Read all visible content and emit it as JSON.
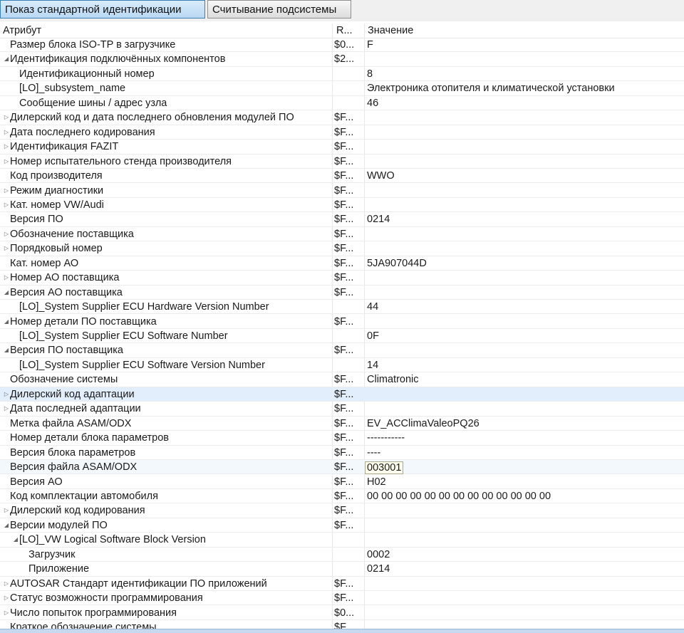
{
  "tabs": [
    {
      "label": "Показ стандартной идентификации",
      "active": true
    },
    {
      "label": "Считывание подсистемы",
      "active": false
    }
  ],
  "columns": {
    "attribute": "Атрибут",
    "raw": "R...",
    "value": "Значение"
  },
  "rows": [
    {
      "attr": "Размер блока ISO-TP в загрузчике",
      "level": 0,
      "toggle": "none",
      "raw": "$0...",
      "value": "F"
    },
    {
      "attr": "Идентификация подключённых компонентов",
      "level": 0,
      "toggle": "expanded",
      "raw": "$2...",
      "value": ""
    },
    {
      "attr": "Идентификационный номер",
      "level": 1,
      "toggle": "none",
      "raw": "",
      "value": "8"
    },
    {
      "attr": "[LO]_subsystem_name",
      "level": 1,
      "toggle": "none",
      "raw": "",
      "value": "Электроника отопителя и климатической установки"
    },
    {
      "attr": "Сообщение шины / адрес узла",
      "level": 1,
      "toggle": "none",
      "raw": "",
      "value": "46"
    },
    {
      "attr": "Дилерский код и дата последнего обновления модулей ПО",
      "level": 0,
      "toggle": "collapsed",
      "raw": "$F...",
      "value": ""
    },
    {
      "attr": "Дата последнего кодирования",
      "level": 0,
      "toggle": "collapsed",
      "raw": "$F...",
      "value": ""
    },
    {
      "attr": "Идентификация FAZIT",
      "level": 0,
      "toggle": "collapsed",
      "raw": "$F...",
      "value": ""
    },
    {
      "attr": "Номер испытательного стенда производителя",
      "level": 0,
      "toggle": "collapsed",
      "raw": "$F...",
      "value": ""
    },
    {
      "attr": "Код производителя",
      "level": 0,
      "toggle": "none",
      "raw": "$F...",
      "value": "WWO"
    },
    {
      "attr": "Режим диагностики",
      "level": 0,
      "toggle": "collapsed",
      "raw": "$F...",
      "value": ""
    },
    {
      "attr": "Кат. номер VW/Audi",
      "level": 0,
      "toggle": "collapsed",
      "raw": "$F...",
      "value": ""
    },
    {
      "attr": "Версия ПО",
      "level": 0,
      "toggle": "none",
      "raw": "$F...",
      "value": "0214"
    },
    {
      "attr": "Обозначение поставщика",
      "level": 0,
      "toggle": "collapsed",
      "raw": "$F...",
      "value": ""
    },
    {
      "attr": "Порядковый номер",
      "level": 0,
      "toggle": "collapsed",
      "raw": "$F...",
      "value": ""
    },
    {
      "attr": "Кат. номер АО",
      "level": 0,
      "toggle": "none",
      "raw": "$F...",
      "value": "5JA907044D"
    },
    {
      "attr": "Номер АО поставщика",
      "level": 0,
      "toggle": "collapsed",
      "raw": "$F...",
      "value": ""
    },
    {
      "attr": "Версия АО поставщика",
      "level": 0,
      "toggle": "expanded",
      "raw": "$F...",
      "value": ""
    },
    {
      "attr": "[LO]_System Supplier ECU Hardware Version Number",
      "level": 1,
      "toggle": "none",
      "raw": "",
      "value": "44"
    },
    {
      "attr": "Номер детали ПО поставщика",
      "level": 0,
      "toggle": "expanded",
      "raw": "$F...",
      "value": ""
    },
    {
      "attr": "[LO]_System Supplier ECU Software Number",
      "level": 1,
      "toggle": "none",
      "raw": "",
      "value": "0F"
    },
    {
      "attr": "Версия ПО поставщика",
      "level": 0,
      "toggle": "expanded",
      "raw": "$F...",
      "value": ""
    },
    {
      "attr": "[LO]_System Supplier ECU Software Version Number",
      "level": 1,
      "toggle": "none",
      "raw": "",
      "value": "14"
    },
    {
      "attr": "Обозначение системы",
      "level": 0,
      "toggle": "none",
      "raw": "$F...",
      "value": "Climatronic"
    },
    {
      "attr": "Дилерский код адаптации",
      "level": 0,
      "toggle": "collapsed",
      "raw": "$F...",
      "value": "",
      "selected": true
    },
    {
      "attr": "Дата последней адаптации",
      "level": 0,
      "toggle": "collapsed",
      "raw": "$F...",
      "value": ""
    },
    {
      "attr": "Метка файла ASAM/ODX",
      "level": 0,
      "toggle": "none",
      "raw": "$F...",
      "value": "EV_ACClimaValeoPQ26"
    },
    {
      "attr": "Номер детали блока параметров",
      "level": 0,
      "toggle": "none",
      "raw": "$F...",
      "value": "-----------"
    },
    {
      "attr": "Версия блока параметров",
      "level": 0,
      "toggle": "none",
      "raw": "$F...",
      "value": "----"
    },
    {
      "attr": "Версия файла ASAM/ODX",
      "level": 0,
      "toggle": "none",
      "raw": "$F...",
      "value": "003001",
      "hover": true
    },
    {
      "attr": "Версия АО",
      "level": 0,
      "toggle": "none",
      "raw": "$F...",
      "value": "H02"
    },
    {
      "attr": "Код комплектации автомобиля",
      "level": 0,
      "toggle": "none",
      "raw": "$F...",
      "value": "00 00 00 00 00 00 00 00 00 00 00 00 00"
    },
    {
      "attr": "Дилерский код кодирования",
      "level": 0,
      "toggle": "collapsed",
      "raw": "$F...",
      "value": ""
    },
    {
      "attr": "Версии модулей ПО",
      "level": 0,
      "toggle": "expanded",
      "raw": "$F...",
      "value": ""
    },
    {
      "attr": "[LO]_VW Logical Software Block Version",
      "level": 1,
      "toggle": "expanded",
      "raw": "",
      "value": ""
    },
    {
      "attr": "Загрузчик",
      "level": 2,
      "toggle": "none",
      "raw": "",
      "value": "0002"
    },
    {
      "attr": "Приложение",
      "level": 2,
      "toggle": "none",
      "raw": "",
      "value": "0214"
    },
    {
      "attr": "AUTOSAR Стандарт идентификации ПО приложений",
      "level": 0,
      "toggle": "collapsed",
      "raw": "$F...",
      "value": ""
    },
    {
      "attr": "Статус возможности программирования",
      "level": 0,
      "toggle": "collapsed",
      "raw": "$F...",
      "value": ""
    },
    {
      "attr": "Число попыток программирования",
      "level": 0,
      "toggle": "collapsed",
      "raw": "$0...",
      "value": ""
    },
    {
      "attr": "Краткое обозначение системы",
      "level": 0,
      "toggle": "none",
      "raw": "$F...",
      "value": ""
    }
  ]
}
